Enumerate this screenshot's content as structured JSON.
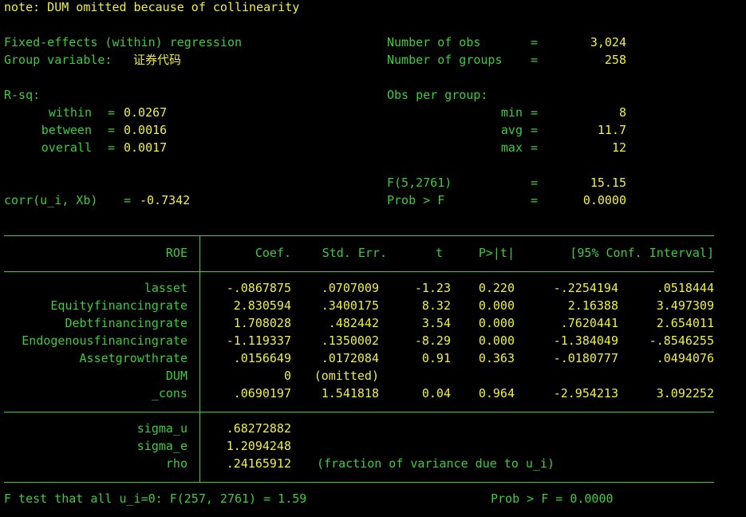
{
  "note": "note: DUM omitted because of collinearity",
  "header": {
    "title": "Fixed-effects (within) regression",
    "group_var_label": "Group variable:",
    "group_var_value": "证券代码",
    "nobs_label": "Number of obs",
    "nobs_value": "3,024",
    "ngroups_label": "Number of groups",
    "ngroups_value": "258",
    "rsq_label": "R-sq:",
    "within_label": "within",
    "within_value": "0.0267",
    "between_label": "between",
    "between_value": "0.0016",
    "overall_label": "overall",
    "overall_value": "0.0017",
    "obs_per_group_label": "Obs per group:",
    "min_label": "min",
    "min_value": "8",
    "avg_label": "avg",
    "avg_value": "11.7",
    "max_label": "max",
    "max_value": "12",
    "ftest_label": "F(5,2761)",
    "ftest_value": "15.15",
    "corr_label": "corr(u_i, Xb)",
    "corr_value": "-0.7342",
    "probf_label": "Prob > F",
    "probf_value": "0.0000",
    "eq": "="
  },
  "table": {
    "depvar": "ROE",
    "columns": [
      "Coef.",
      "Std. Err.",
      "t",
      "P>|t|",
      "[95% Conf. Interval]"
    ],
    "rows": [
      {
        "var": "lasset",
        "coef": "-.0867875",
        "se": ".0707009",
        "t": "-1.23",
        "p": "0.220",
        "lo": "-.2254194",
        "hi": ".0518444"
      },
      {
        "var": "Equityfinancingrate",
        "coef": "2.830594",
        "se": ".3400175",
        "t": "8.32",
        "p": "0.000",
        "lo": "2.16388",
        "hi": "3.497309"
      },
      {
        "var": "Debtfinancingrate",
        "coef": "1.708028",
        "se": ".482442",
        "t": "3.54",
        "p": "0.000",
        "lo": ".7620441",
        "hi": "2.654011"
      },
      {
        "var": "Endogenousfinancingrate",
        "coef": "-1.119337",
        "se": ".1350002",
        "t": "-8.29",
        "p": "0.000",
        "lo": "-1.384049",
        "hi": "-.8546255"
      },
      {
        "var": "Assetgrowthrate",
        "coef": ".0156649",
        "se": ".0172084",
        "t": "0.91",
        "p": "0.363",
        "lo": "-.0180777",
        "hi": ".0494076"
      },
      {
        "var": "DUM",
        "coef": "0",
        "se": "(omitted)",
        "t": "",
        "p": "",
        "lo": "",
        "hi": ""
      },
      {
        "var": "_cons",
        "coef": ".0690197",
        "se": "1.541818",
        "t": "0.04",
        "p": "0.964",
        "lo": "-2.954213",
        "hi": "3.092252"
      }
    ],
    "sigma": [
      {
        "var": "sigma_u",
        "value": ".68272882",
        "note": ""
      },
      {
        "var": "sigma_e",
        "value": "1.2094248",
        "note": ""
      },
      {
        "var": "rho",
        "value": ".24165912",
        "note": "(fraction of variance due to u_i)"
      }
    ]
  },
  "footer": {
    "ftest": "F test that all u_i=0: F(257, 2761) = 1.59",
    "probf": "Prob > F = 0.0000"
  },
  "colors": {
    "background": "#000000",
    "green": "#3ccc3c",
    "yellow": "#f0f03c",
    "white": "#f0f0f0"
  }
}
